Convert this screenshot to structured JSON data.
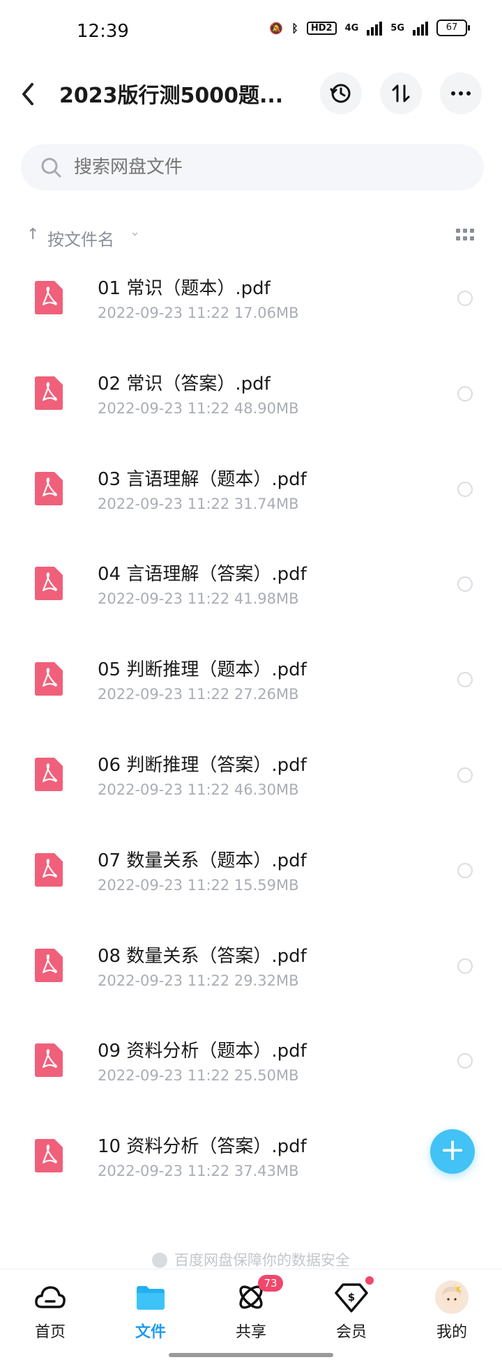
{
  "status_bar": {
    "time": "12:39",
    "hd_label": "HD2",
    "net1": "4G",
    "net2": "5G",
    "battery": "67"
  },
  "header": {
    "title": "2023版行测5000题..."
  },
  "search": {
    "placeholder": "搜索网盘文件"
  },
  "sort": {
    "label": "按文件名"
  },
  "files": [
    {
      "name": "01 常识（题本）.pdf",
      "meta": "2022-09-23  11:22   17.06MB"
    },
    {
      "name": "02 常识（答案）.pdf",
      "meta": "2022-09-23  11:22   48.90MB"
    },
    {
      "name": "03 言语理解（题本）.pdf",
      "meta": "2022-09-23  11:22   31.74MB"
    },
    {
      "name": "04 言语理解（答案）.pdf",
      "meta": "2022-09-23  11:22   41.98MB"
    },
    {
      "name": "05 判断推理（题本）.pdf",
      "meta": "2022-09-23  11:22   27.26MB"
    },
    {
      "name": "06 判断推理（答案）.pdf",
      "meta": "2022-09-23  11:22   46.30MB"
    },
    {
      "name": "07 数量关系（题本）.pdf",
      "meta": "2022-09-23  11:22   15.59MB"
    },
    {
      "name": "08 数量关系（答案）.pdf",
      "meta": "2022-09-23  11:22   29.32MB"
    },
    {
      "name": "09 资料分析（题本）.pdf",
      "meta": "2022-09-23  11:22   25.50MB"
    },
    {
      "name": "10 资料分析（答案）.pdf",
      "meta": "2022-09-23  11:22   37.43MB"
    }
  ],
  "security_note": "百度网盘保障你的数据安全",
  "tabs": [
    {
      "label": "首页",
      "icon": "cloud-icon"
    },
    {
      "label": "文件",
      "icon": "folder-icon"
    },
    {
      "label": "共享",
      "icon": "share-icon",
      "badge": "73"
    },
    {
      "label": "会员",
      "icon": "vip-icon"
    },
    {
      "label": "我的",
      "icon": "avatar"
    }
  ],
  "colors": {
    "accent": "#1f9bf0",
    "pdf": "#f0607a",
    "fab": "#43c2f5",
    "badge": "#f0476b"
  }
}
